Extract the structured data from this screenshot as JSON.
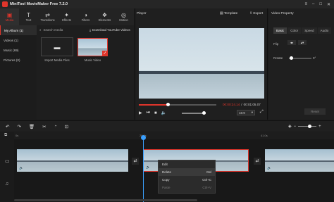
{
  "window": {
    "title": "MiniTool MovieMaker Free 7.2.0",
    "controls": [
      "≡",
      "–",
      "□",
      "✕"
    ]
  },
  "toolbar": {
    "items": [
      {
        "label": "Media",
        "icon": "folder-icon",
        "glyph": "▣"
      },
      {
        "label": "Text",
        "icon": "text-icon",
        "glyph": "T"
      },
      {
        "label": "Transitions",
        "icon": "transitions-icon",
        "glyph": "⇄"
      },
      {
        "label": "Effects",
        "icon": "effects-icon",
        "glyph": "✦"
      },
      {
        "label": "Filters",
        "icon": "filters-icon",
        "glyph": "◑"
      },
      {
        "label": "Elements",
        "icon": "elements-icon",
        "glyph": "❖"
      },
      {
        "label": "Motion",
        "icon": "motion-icon",
        "glyph": "◎"
      }
    ]
  },
  "sidenav": {
    "items": [
      {
        "label": "My Album (1)",
        "active": true
      },
      {
        "label": "Videos (1)",
        "active": false
      },
      {
        "label": "Music (69)",
        "active": false
      },
      {
        "label": "Pictures (0)",
        "active": false
      }
    ]
  },
  "media": {
    "search_label": "Search media",
    "youtube_label": "Download YouTube Videos",
    "import_label": "Import Media Files",
    "clip_label": "Music Video"
  },
  "player": {
    "label": "Player",
    "template_label": "Template",
    "export_label": "Export",
    "time_current": "00:00:24.14",
    "time_sep": "/",
    "time_total": "00:01:05.07",
    "aspect": "16:9",
    "progress": 0.37
  },
  "properties": {
    "label": "Video Property",
    "tabs": [
      {
        "label": "Basic",
        "active": true
      },
      {
        "label": "Color",
        "active": false
      },
      {
        "label": "Speed",
        "active": false
      },
      {
        "label": "Audio",
        "active": false
      }
    ],
    "flip_label": "Flip",
    "rotate_label": "Rotate",
    "rotate_value": "0°",
    "reset_label": "Reset"
  },
  "timeline": {
    "ruler": [
      "0s",
      "26.0s",
      "41.0s"
    ],
    "tools": [
      "↶",
      "↷",
      "🗑",
      "✂",
      "◔",
      "⊡"
    ],
    "context_menu": [
      {
        "label": "Edit",
        "shortcut": "",
        "state": "normal"
      },
      {
        "label": "Delete",
        "shortcut": "Del",
        "state": "highlight"
      },
      {
        "label": "Copy",
        "shortcut": "Ctrl+C",
        "state": "normal"
      },
      {
        "label": "Paste",
        "shortcut": "Ctrl+V",
        "state": "disabled"
      }
    ]
  },
  "colors": {
    "accent": "#e0352b",
    "playhead": "#3aa0ff"
  }
}
